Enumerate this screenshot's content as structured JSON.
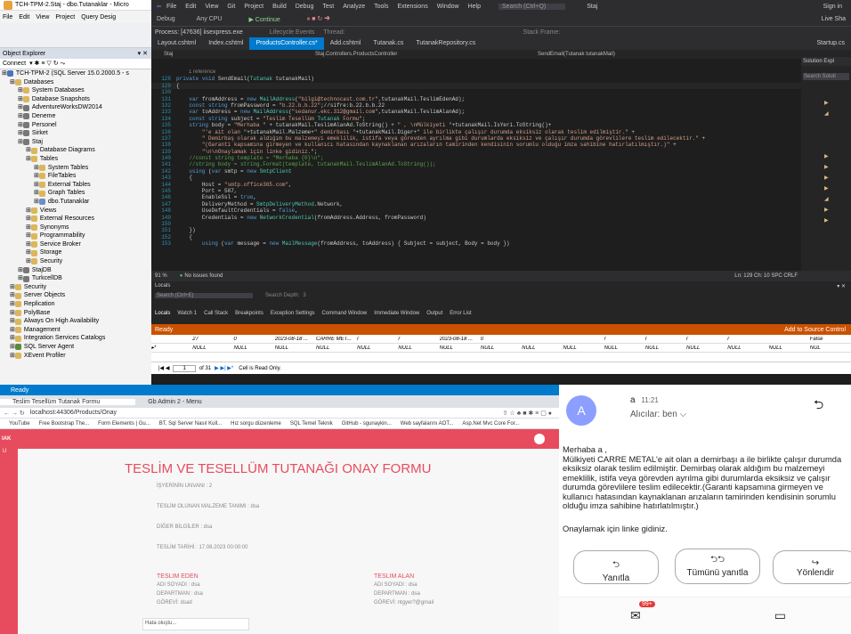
{
  "ssms": {
    "title": "TCH-TPM-2.Staj - dbo.Tutanaklar - Micro",
    "menu": [
      "File",
      "Edit",
      "View",
      "Project",
      "Query Desig"
    ],
    "object_explorer": {
      "title": "Object Explorer",
      "connect": "Connect",
      "tree": [
        {
          "label": "TCH-TPM-2 (SQL Server 15.0.2000.5 - s",
          "indent": 0,
          "icon": "server-icon"
        },
        {
          "label": "Databases",
          "indent": 1,
          "icon": "folder-icon"
        },
        {
          "label": "System Databases",
          "indent": 2,
          "icon": "folder-icon"
        },
        {
          "label": "Database Snapshots",
          "indent": 2,
          "icon": "folder-icon"
        },
        {
          "label": "AdventureWorksDW2014",
          "indent": 2,
          "icon": "database-icon"
        },
        {
          "label": "Deneme",
          "indent": 2,
          "icon": "database-icon"
        },
        {
          "label": "Personel",
          "indent": 2,
          "icon": "database-icon"
        },
        {
          "label": "Sirket",
          "indent": 2,
          "icon": "database-icon"
        },
        {
          "label": "Staj",
          "indent": 2,
          "icon": "database-icon"
        },
        {
          "label": "Database Diagrams",
          "indent": 3,
          "icon": "folder-icon"
        },
        {
          "label": "Tables",
          "indent": 3,
          "icon": "folder-icon"
        },
        {
          "label": "System Tables",
          "indent": 4,
          "icon": "folder-icon"
        },
        {
          "label": "FileTables",
          "indent": 4,
          "icon": "folder-icon"
        },
        {
          "label": "External Tables",
          "indent": 4,
          "icon": "folder-icon"
        },
        {
          "label": "Graph Tables",
          "indent": 4,
          "icon": "folder-icon"
        },
        {
          "label": "dbo.Tutanaklar",
          "indent": 4,
          "icon": "table-icon"
        },
        {
          "label": "Views",
          "indent": 3,
          "icon": "folder-icon"
        },
        {
          "label": "External Resources",
          "indent": 3,
          "icon": "folder-icon"
        },
        {
          "label": "Synonyms",
          "indent": 3,
          "icon": "folder-icon"
        },
        {
          "label": "Programmability",
          "indent": 3,
          "icon": "folder-icon"
        },
        {
          "label": "Service Broker",
          "indent": 3,
          "icon": "folder-icon"
        },
        {
          "label": "Storage",
          "indent": 3,
          "icon": "folder-icon"
        },
        {
          "label": "Security",
          "indent": 3,
          "icon": "folder-icon"
        },
        {
          "label": "StajDB",
          "indent": 2,
          "icon": "database-icon"
        },
        {
          "label": "TurkcellDB",
          "indent": 2,
          "icon": "database-icon"
        },
        {
          "label": "Security",
          "indent": 1,
          "icon": "folder-icon"
        },
        {
          "label": "Server Objects",
          "indent": 1,
          "icon": "folder-icon"
        },
        {
          "label": "Replication",
          "indent": 1,
          "icon": "folder-icon"
        },
        {
          "label": "PolyBase",
          "indent": 1,
          "icon": "folder-icon"
        },
        {
          "label": "Always On High Availability",
          "indent": 1,
          "icon": "folder-icon"
        },
        {
          "label": "Management",
          "indent": 1,
          "icon": "folder-icon"
        },
        {
          "label": "Integration Services Catalogs",
          "indent": 1,
          "icon": "folder-icon"
        },
        {
          "label": "SQL Server Agent",
          "indent": 1,
          "icon": "agent-icon"
        },
        {
          "label": "XEvent Profiler",
          "indent": 1,
          "icon": "folder-icon"
        }
      ]
    }
  },
  "vs": {
    "menu": [
      "File",
      "Edit",
      "View",
      "Git",
      "Project",
      "Build",
      "Debug",
      "Test",
      "Analyze",
      "Tools",
      "Extensions",
      "Window",
      "Help"
    ],
    "search_placeholder": "Search (Ctrl+Q)",
    "solution": "Staj",
    "sign_in": "Sign in",
    "live_share": "Live Sha",
    "process": "Process: [47636] iisexpress.exe",
    "lifecycle": "Lifecycle Events",
    "thread": "Thread:",
    "stack_frame": "Stack Frame:",
    "toolbar_continue": "Continue",
    "any_cpu": "Any CPU",
    "debug_mode": "Debug",
    "tabs": [
      "Layout.cshtml",
      "Index.cshtml",
      "ProductsController.cs*",
      "Add.cshtml",
      "Tutanak.cs",
      "TutanakRepository.cs",
      "Startup.cs"
    ],
    "active_tab": "ProductsController.cs*",
    "breadcrumb_left": "Staj",
    "breadcrumb_mid": "Staj.Controllers.ProductsController",
    "breadcrumb_right": "SendEmail(Tutanak tutanakMail)",
    "references": "1 reference",
    "code": [
      {
        "n": "128",
        "t": "private void SendEmail(Tutanak tutanakMail)"
      },
      {
        "n": "129",
        "t": "{"
      },
      {
        "n": "130",
        "t": ""
      },
      {
        "n": "131",
        "t": "    var fromAddress = new MailAddress(\"bilgi@technocast.com.tr\",tutanakMail.TeslimEdenAd);"
      },
      {
        "n": "132",
        "t": "    const string fromPassword = \"b.22.b.b.22\";//sifre:b.22.b.b.22"
      },
      {
        "n": "133",
        "t": "    var toAddress = new MailAddress(\"sedanur.ekc.312@gmail.com\",tutanakMail.TeslimAlanAd);"
      },
      {
        "n": "134",
        "t": "    const string subject = \"Teslim Tesellüm Tutanak Formu\";"
      },
      {
        "n": "135",
        "t": "    string body = \"Merhaba \" + tutanakMail.TeslimAlanAd.ToString() + \" , \\nMülkiyeti \"+tutanakMail.IsYeri.ToString()+"
      },
      {
        "n": "136",
        "t": "        \"'e ait olan \"+tutanakMail.Malzeme+\" demirbası \"+tutanakMail.Diger+\" ile birlikte çalışır durumda eksiksiz olarak teslim edilmiştir.\" +"
      },
      {
        "n": "137",
        "t": "        \" Demirbaş olarak aldığım bu malzemeyi emeklilik, istifa veya görevden ayrılma gibi durumlarda eksiksiz ve çalışır durumda görevlilere teslim edilecektir.\" +"
      },
      {
        "n": "138",
        "t": "        \"(Garanti kapsamına girmeyen ve kullanıcı hatasından kaynaklanan arızaların tamirinden kendisinin sorumlu olduğu imza sahibine hatırlatılmıştır.)\" +"
      },
      {
        "n": "139",
        "t": "        \"\\n\\nOnaylamak için linke gidiniz.\";"
      },
      {
        "n": "140",
        "t": "    //const string template = \"Merhaba {0}\\n\";"
      },
      {
        "n": "141",
        "t": "    //string body = string.Format(template, tutanakMail.TeslimAlanAd.ToString());"
      },
      {
        "n": "142",
        "t": "    using (var smtp = new SmtpClient"
      },
      {
        "n": "143",
        "t": "    {"
      },
      {
        "n": "144",
        "t": "        Host = \"smtp.office365.com\","
      },
      {
        "n": "145",
        "t": "        Port = 587,"
      },
      {
        "n": "146",
        "t": "        EnableSsl = true,"
      },
      {
        "n": "147",
        "t": "        DeliveryMethod = SmtpDeliveryMethod.Network,"
      },
      {
        "n": "148",
        "t": "        UseDefaultCredentials = false,"
      },
      {
        "n": "149",
        "t": "        Credentials = new NetworkCredential(fromAddress.Address, fromPassword)"
      },
      {
        "n": "150",
        "t": ""
      },
      {
        "n": "151",
        "t": "    })"
      },
      {
        "n": "152",
        "t": "    {"
      },
      {
        "n": "153",
        "t": "        using (var message = new MailMessage(fromAddress, toAddress) { Subject = subject, Body = body })"
      }
    ],
    "zoom": "91 %",
    "no_issues": "No issues found",
    "cursor": "Ln: 129   Ch: 10   SPC   CRLF",
    "locals_title": "Locals",
    "locals_search": "Search (Ctrl+E)",
    "search_depth": "Search Depth:",
    "search_depth_value": "3",
    "bottom_tabs": [
      "Locals",
      "Watch 1",
      "Call Stack",
      "Breakpoints",
      "Exception Settings",
      "Command Window",
      "Immediate Window",
      "Output",
      "Error List"
    ],
    "ready": "Ready",
    "add_to_source": "Add to Source Control",
    "solution_explorer": "Solution Expl",
    "search_solution": "Search Soluti",
    "grid_rows": [
      [
        "27",
        "0",
        "2023-08-18 ...",
        "CARRE MET...",
        "r",
        "r",
        "2023-08-18 ...",
        "0",
        "",
        "",
        "r",
        "r",
        "r",
        "r",
        "",
        "False"
      ],
      [
        "NULL",
        "NULL",
        "NULL",
        "NULL",
        "NULL",
        "NULL",
        "NULL",
        "NULL",
        "NULL",
        "NULL",
        "NULL",
        "NULL",
        "NULL",
        "NULL",
        "NULL",
        "NUL"
      ]
    ],
    "pager_pos": "1",
    "pager_total": "of 31",
    "read_only": "Cell is Read Only.",
    "app_status": "Ready"
  },
  "browser": {
    "tabs": [
      "Teslim Tesellüm Tutanak Formu",
      "Gb Admin 2 - Menu"
    ],
    "url": "localhost:44306/Products/Onay",
    "bookmarks": [
      "YouTube",
      "Free Bootstrap The...",
      "Form Elements | Gu...",
      "BT, Sql Server Nasıl Kull...",
      "Hız sorgu düzenleme",
      "SQL Temel Teknik",
      "GitHub - sgunaykin...",
      "Web sayfalarını AOT...",
      "Asp.Net Mvc Core For..."
    ],
    "brand": "IAK",
    "side_item": "U",
    "form_title": "TESLİM VE TESELLÜM TUTANAĞI ONAY FORMU",
    "fields": [
      "İŞYERİNİN UNVANI : 2",
      "TESLİM OLUNAN MALZEME TANIMI : dsa",
      "DİĞER BİLGİLER : dsa",
      "TESLİM TARİHİ : 17.08.2023 00:00:00"
    ],
    "left_col": {
      "title": "TESLİM EDEN",
      "rows": [
        "ADI SOYADI : dsa",
        "DEPARTMAN : dsa",
        "GÖREVİ: dsad"
      ]
    },
    "right_col": {
      "title": "TESLİM ALAN",
      "rows": [
        "ADI SOYADI : dsa",
        "DEPARTMAN : dsa",
        "GÖREVİ: ntgyer?@gmail"
      ]
    },
    "image_alt": "Hata oluştu..."
  },
  "phone": {
    "avatar": "A",
    "sender": "a",
    "time": "11:21",
    "recipient": "Alıcılar: ben",
    "message": "Merhaba a ,\nMülkiyeti CARRE METAL'e ait olan a demirbaşı a ile birlikte çalışır durumda eksiksiz olarak teslim edilmiştir. Demirbaş olarak aldığım bu malzemeyi emeklilik, istifa veya görevden ayrılma gibi durumlarda eksiksiz ve çalışır durumda görevlilere teslim edilecektir.(Garanti kapsamına girmeyen ve kullanıcı hatasından kaynaklanan arızaların tamirinden kendisinin sorumlu olduğu imza sahibine hatırlatılmıştır.)",
    "message2": "Onaylamak için linke gidiniz.",
    "buttons": [
      "Yanıtla",
      "Tümünü yanıtla",
      "Yönlendir"
    ],
    "badge": "99+"
  },
  "colors": {
    "accent": "#007acc",
    "red": "#e74c5e",
    "ready_orange": "#ca5100"
  }
}
